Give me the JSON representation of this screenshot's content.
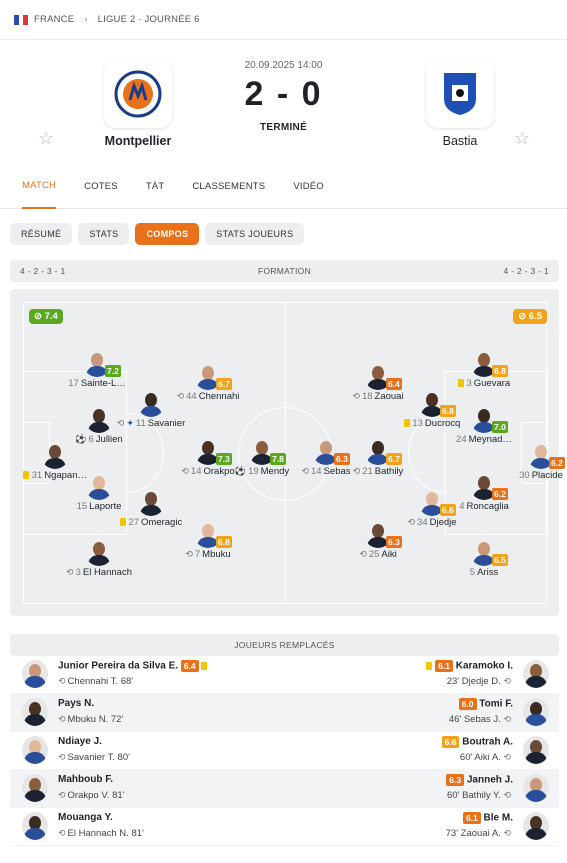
{
  "breadcrumb": {
    "country": "FRANCE",
    "competition": "LIGUE 2 · JOURNÉE 6"
  },
  "match": {
    "datetime": "20.09.2025 14:00",
    "score": "2 - 0",
    "status": "TERMINÉ",
    "home": {
      "name": "Montpellier"
    },
    "away": {
      "name": "Bastia"
    }
  },
  "tabs": [
    "MATCH",
    "COTES",
    "TÀT",
    "CLASSEMENTS",
    "VIDÉO"
  ],
  "subtabs": [
    "RÉSUMÉ",
    "STATS",
    "COMPOS",
    "STATS JOUEURS"
  ],
  "formation": {
    "label": "FORMATION",
    "home": "4 - 2 - 3 - 1",
    "away": "4 - 2 - 3 - 1",
    "home_rating": "⊘ 7.4",
    "away_rating": "⊘ 6.5"
  },
  "colors": {
    "accent": "#e8711a",
    "green": "#5aa81e",
    "orange": "#e8711a",
    "amber": "#f3a21b"
  },
  "home_players": [
    {
      "num": "31",
      "name": "Ngapan…",
      "rating": "",
      "yellow": true
    },
    {
      "num": "17",
      "name": "Sainte-L…",
      "rating": "7.2"
    },
    {
      "num": "6",
      "name": "Jullien",
      "rating": "",
      "ball": true
    },
    {
      "num": "15",
      "name": "Laporte",
      "rating": ""
    },
    {
      "num": "3",
      "name": "El Hannach",
      "rating": "",
      "sub": true
    },
    {
      "num": "11",
      "name": "Savanier",
      "rating": "",
      "sub": true,
      "assist": true
    },
    {
      "num": "27",
      "name": "Omeragic",
      "rating": "",
      "yellow": true
    },
    {
      "num": "44",
      "name": "Chennahi",
      "rating": "6.7",
      "sub": true
    },
    {
      "num": "14",
      "name": "Orakpo",
      "rating": "7.3",
      "sub": true
    },
    {
      "num": "7",
      "name": "Mbuku",
      "rating": "6.8",
      "sub": true
    },
    {
      "num": "19",
      "name": "Mendy",
      "rating": "7.8",
      "ball": true
    }
  ],
  "away_players": [
    {
      "num": "30",
      "name": "Placide",
      "rating": "6.2"
    },
    {
      "num": "3",
      "name": "Guevara",
      "rating": "6.8",
      "yellow": true
    },
    {
      "num": "24",
      "name": "Meynad…",
      "rating": "7.0"
    },
    {
      "num": "4",
      "name": "Roncaglia",
      "rating": "6.2"
    },
    {
      "num": "5",
      "name": "Ariss",
      "rating": "6.5"
    },
    {
      "num": "13",
      "name": "Ducrocq",
      "rating": "6.8",
      "yellow": true
    },
    {
      "num": "34",
      "name": "Djedje",
      "rating": "6.6",
      "sub": true
    },
    {
      "num": "18",
      "name": "Zaouai",
      "rating": "6.4",
      "sub": true
    },
    {
      "num": "21",
      "name": "Bathily",
      "rating": "6.7",
      "sub": true
    },
    {
      "num": "25",
      "name": "Aiki",
      "rating": "6.3",
      "sub": true
    },
    {
      "num": "14",
      "name": "Sebas",
      "rating": "6.3",
      "sub": true
    }
  ],
  "subs": {
    "title": "JOUEURS REMPLACÉS",
    "rows": [
      {
        "home_in": "Junior Pereira da Silva E.",
        "home_rating": "6.4",
        "home_yellow": true,
        "home_out": "Chennahi T. 68'",
        "away_in": "Karamoko I.",
        "away_rating": "6.1",
        "away_yellow": true,
        "away_out": "23' Djedje D."
      },
      {
        "home_in": "Pays N.",
        "home_rating": "",
        "home_out": "Mbuku N. 72'",
        "away_in": "Tomi F.",
        "away_rating": "6.0",
        "away_out": "46' Sebas J."
      },
      {
        "home_in": "Ndiaye J.",
        "home_rating": "",
        "home_out": "Savanier T. 80'",
        "away_in": "Boutrah A.",
        "away_rating": "6.6",
        "away_out": "60' Aiki A."
      },
      {
        "home_in": "Mahboub F.",
        "home_rating": "",
        "home_out": "Orakpo V. 81'",
        "away_in": "Janneh J.",
        "away_rating": "6.3",
        "away_out": "60' Bathily Y."
      },
      {
        "home_in": "Mouanga Y.",
        "home_rating": "",
        "home_out": "El Hannach N. 81'",
        "away_in": "Ble M.",
        "away_rating": "6.1",
        "away_out": "73' Zaouai A."
      }
    ]
  }
}
